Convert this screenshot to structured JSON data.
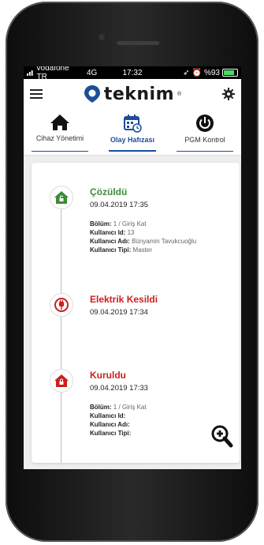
{
  "status_bar": {
    "carrier": "vodafone TR",
    "network": "4G",
    "time": "17:32",
    "battery": "%93",
    "battery_level": 0.93
  },
  "app": {
    "logo_text": "teknim",
    "logo_mark": "®"
  },
  "tabs": [
    {
      "label": "Cihaz Yönetimi",
      "icon": "home-icon"
    },
    {
      "label": "Olay Hafızası",
      "icon": "calendar-icon"
    },
    {
      "label": "PGM Kontrol",
      "icon": "power-icon"
    }
  ],
  "events": [
    {
      "title": "Çözüldü",
      "color": "#3d8b37",
      "icon": "home-unlocked-icon",
      "date": "09.04.2019 17:35",
      "details": [
        {
          "label": "Bölüm:",
          "value": "1 / Giriş Kat"
        },
        {
          "label": "Kullanıcı Id:",
          "value": "13"
        },
        {
          "label": "Kullanıcı Adı:",
          "value": "Bünyamin Tavukcuoğlu"
        },
        {
          "label": "Kullanıcı Tipi:",
          "value": "Master"
        }
      ]
    },
    {
      "title": "Elektrik Kesildi",
      "color": "#cc1f1f",
      "icon": "power-plug-icon",
      "date": "09.04.2019 17:34",
      "details": []
    },
    {
      "title": "Kuruldu",
      "color": "#cc1f1f",
      "icon": "home-locked-icon",
      "date": "09.04.2019 17:33",
      "details": [
        {
          "label": "Bölüm:",
          "value": "1 / Giriş Kat"
        },
        {
          "label": "Kullanıcı Id:",
          "value": ""
        },
        {
          "label": "Kullanıcı Adı:",
          "value": ""
        },
        {
          "label": "Kullanıcı Tipi:",
          "value": ""
        }
      ]
    }
  ],
  "colors": {
    "brand_blue": "#1b4f9c",
    "resolved_green": "#3d8b37",
    "alarm_red": "#cc1f1f"
  }
}
